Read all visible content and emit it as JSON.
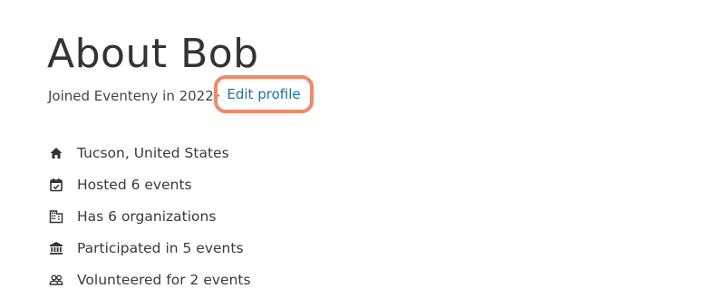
{
  "profile": {
    "title": "About Bob",
    "joined_text": "Joined Eventeny in 2022",
    "separator": "·",
    "edit_label": "Edit profile",
    "highlight_color": "#f4876b",
    "link_color": "#1b6fb8"
  },
  "stats": [
    {
      "icon": "home-icon",
      "label": "Tucson, United States"
    },
    {
      "icon": "calendar-check-icon",
      "label": "Hosted 6 events"
    },
    {
      "icon": "building-icon",
      "label": "Has 6 organizations"
    },
    {
      "icon": "institution-icon",
      "label": "Participated in 5 events"
    },
    {
      "icon": "people-icon",
      "label": "Volunteered for 2 events"
    }
  ]
}
